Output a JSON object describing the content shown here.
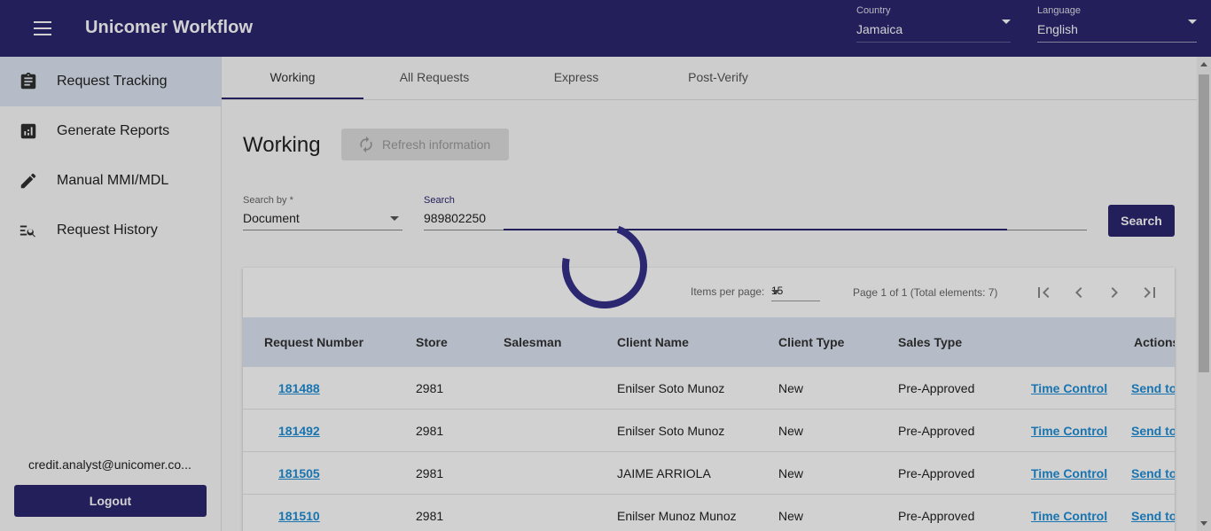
{
  "header": {
    "app_title": "Unicomer Workflow",
    "country": {
      "label": "Country",
      "value": "Jamaica"
    },
    "language": {
      "label": "Language",
      "value": "English"
    }
  },
  "sidebar": {
    "items": [
      {
        "label": "Request Tracking",
        "icon": "clipboard-icon",
        "active": true
      },
      {
        "label": "Generate Reports",
        "icon": "report-chart-icon",
        "active": false
      },
      {
        "label": "Manual MMI/MDL",
        "icon": "pencil-icon",
        "active": false
      },
      {
        "label": "Request History",
        "icon": "search-list-icon",
        "active": false
      }
    ],
    "user_email": "credit.analyst@unicomer.co...",
    "logout_label": "Logout"
  },
  "tabs": [
    "Working",
    "All Requests",
    "Express",
    "Post-Verify"
  ],
  "main": {
    "title": "Working",
    "refresh_label": "Refresh information",
    "search_by": {
      "label": "Search by *",
      "value": "Document"
    },
    "search": {
      "label": "Search",
      "value": "989802250"
    },
    "search_button": "Search"
  },
  "paginator": {
    "items_per_page_label": "Items per page:",
    "items_per_page": "15",
    "range": "Page 1 of 1 (Total elements: 7)"
  },
  "table": {
    "columns": [
      "Request Number",
      "Store",
      "Salesman",
      "Client Name",
      "Client Type",
      "Sales Type",
      "Actions"
    ],
    "rows": [
      {
        "request_number": "181488",
        "store": "2981",
        "salesman": "",
        "client_name": "Enilser Soto Munoz",
        "client_type": "New",
        "sales_type": "Pre-Approved",
        "action1": "Time Control",
        "action2": "Send to"
      },
      {
        "request_number": "181492",
        "store": "2981",
        "salesman": "",
        "client_name": "Enilser Soto Munoz",
        "client_type": "New",
        "sales_type": "Pre-Approved",
        "action1": "Time Control",
        "action2": "Send to"
      },
      {
        "request_number": "181505",
        "store": "2981",
        "salesman": "",
        "client_name": "JAIME ARRIOLA",
        "client_type": "New",
        "sales_type": "Pre-Approved",
        "action1": "Time Control",
        "action2": "Send to"
      },
      {
        "request_number": "181510",
        "store": "2981",
        "salesman": "",
        "client_name": "Enilser Munoz Munoz",
        "client_type": "New",
        "sales_type": "Pre-Approved",
        "action1": "Time Control",
        "action2": "Send to"
      }
    ]
  },
  "colors": {
    "primary": "#2b2770",
    "link": "#1f8ed6",
    "header_row": "#dee6f3"
  }
}
